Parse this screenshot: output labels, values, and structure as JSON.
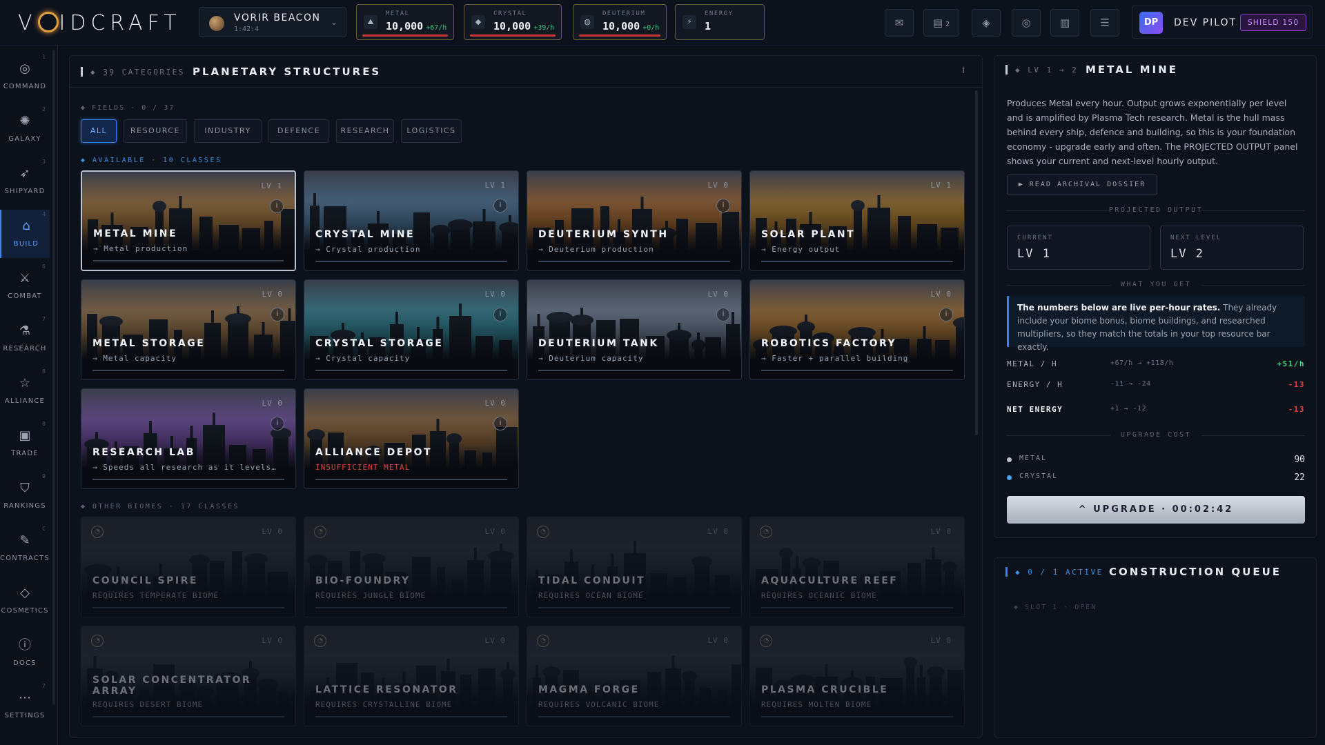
{
  "app": {
    "logo": "VOIDCRAFT"
  },
  "planet": {
    "name": "VORIR BEACON",
    "coords": "1:42:4"
  },
  "resources": [
    {
      "icon": "metal-icon",
      "label": "METAL",
      "value": "10,000",
      "rate": "+67/h"
    },
    {
      "icon": "crystal-icon",
      "label": "CRYSTAL",
      "value": "10,000",
      "rate": "+39/h"
    },
    {
      "icon": "deuterium-icon",
      "label": "DEUTERIUM",
      "value": "10,000",
      "rate": "+0/h"
    },
    {
      "icon": "energy-icon",
      "label": "ENERGY",
      "value": "1",
      "rate": ""
    }
  ],
  "topbar": {
    "buttons": [
      "mail-icon",
      "clipboard-icon",
      "gem-icon",
      "globe-icon",
      "book-icon",
      "menu-icon"
    ],
    "clipboard_count": "2"
  },
  "pilot": {
    "avatar": "DP",
    "name": "DEV PILOT",
    "shield": "SHIELD 150"
  },
  "sidebar": {
    "items": [
      {
        "num": "1",
        "icon": "target-icon",
        "label": "COMMAND"
      },
      {
        "num": "2",
        "icon": "galaxy-icon",
        "label": "GALAXY"
      },
      {
        "num": "3",
        "icon": "rocket-icon",
        "label": "SHIPYARD"
      },
      {
        "num": "4",
        "icon": "build-icon",
        "label": "BUILD"
      },
      {
        "num": "6",
        "icon": "sword-icon",
        "label": "COMBAT"
      },
      {
        "num": "7",
        "icon": "flask-icon",
        "label": "RESEARCH"
      },
      {
        "num": "8",
        "icon": "star-icon",
        "label": "ALLIANCE"
      },
      {
        "num": "0",
        "icon": "bag-icon",
        "label": "TRADE"
      },
      {
        "num": "9",
        "icon": "shield-icon",
        "label": "RANKINGS"
      },
      {
        "num": "C",
        "icon": "pen-icon",
        "label": "CONTRACTS"
      },
      {
        "num": "",
        "icon": "diamond-icon",
        "label": "COSMETICS"
      },
      {
        "num": "",
        "icon": "info-icon",
        "label": "DOCS"
      },
      {
        "num": "7",
        "icon": "dots-icon",
        "label": "SETTINGS"
      }
    ]
  },
  "main": {
    "count": "◆ 39 CATEGORIES",
    "title": "PLANETARY STRUCTURES",
    "info": "i",
    "fields": "◆ FIELDS · 0 / 37",
    "tabs": [
      "ALL",
      "RESOURCE",
      "INDUSTRY",
      "DEFENCE",
      "RESEARCH",
      "LOGISTICS"
    ],
    "available_label": "◆ AVAILABLE · 10 CLASSES",
    "other_label": "◆ OTHER BIOMES · 17 CLASSES",
    "available": [
      {
        "name": "METAL MINE",
        "sub": "→ Metal production",
        "lv": "LV 1",
        "accent": "#c88a3a"
      },
      {
        "name": "CRYSTAL MINE",
        "sub": "→ Crystal production",
        "lv": "LV 1",
        "accent": "#5a8ab0"
      },
      {
        "name": "DEUTERIUM SYNTH",
        "sub": "→ Deuterium production",
        "lv": "LV 0",
        "accent": "#c8782a"
      },
      {
        "name": "SOLAR PLANT",
        "sub": "→ Energy output",
        "lv": "LV 1",
        "accent": "#d0902a"
      },
      {
        "name": "METAL STORAGE",
        "sub": "→ Metal capacity",
        "lv": "LV 0",
        "accent": "#b8864a"
      },
      {
        "name": "CRYSTAL STORAGE",
        "sub": "→ Crystal capacity",
        "lv": "LV 0",
        "accent": "#3aa0b0"
      },
      {
        "name": "DEUTERIUM TANK",
        "sub": "→ Deuterium capacity",
        "lv": "LV 0",
        "accent": "#8a9ab0"
      },
      {
        "name": "ROBOTICS FACTORY",
        "sub": "→ Faster + parallel building",
        "lv": "LV 0",
        "accent": "#d08a30"
      },
      {
        "name": "RESEARCH LAB",
        "sub": "→ Speeds all research as it levels…",
        "lv": "LV 0",
        "accent": "#8a5ac0"
      },
      {
        "name": "ALLIANCE DEPOT",
        "sub": "INSUFFICIENT METAL",
        "lv": "LV 0",
        "accent": "#b07a3a"
      }
    ],
    "other": [
      {
        "name": "COUNCIL SPIRE",
        "sub": "REQUIRES TEMPERATE BIOME",
        "lv": "LV 0"
      },
      {
        "name": "BIO-FOUNDRY",
        "sub": "REQUIRES JUNGLE BIOME",
        "lv": "LV 0"
      },
      {
        "name": "TIDAL CONDUIT",
        "sub": "REQUIRES OCEAN BIOME",
        "lv": "LV 0"
      },
      {
        "name": "AQUACULTURE REEF",
        "sub": "REQUIRES OCEANIC BIOME",
        "lv": "LV 0"
      },
      {
        "name": "SOLAR CONCENTRATOR ARRAY",
        "sub": "REQUIRES DESERT BIOME",
        "lv": "LV 0"
      },
      {
        "name": "LATTICE RESONATOR",
        "sub": "REQUIRES CRYSTALLINE BIOME",
        "lv": "LV 0"
      },
      {
        "name": "MAGMA FORGE",
        "sub": "REQUIRES VOLCANIC BIOME",
        "lv": "LV 0"
      },
      {
        "name": "PLASMA CRUCIBLE",
        "sub": "REQUIRES MOLTEN BIOME",
        "lv": "LV 0"
      }
    ]
  },
  "detail": {
    "sub": "◆ LV 1 → 2",
    "title": "METAL MINE",
    "desc": "Produces Metal every hour. Output grows exponentially per level and is amplified by Plasma Tech research. Metal is the hull mass behind every ship, defence and building, so this is your foundation economy - upgrade early and often. The PROJECTED OUTPUT panel shows your current and next-level hourly output.",
    "dossier": "▶ READ ARCHIVAL DOSSIER",
    "projected_label": "PROJECTED OUTPUT",
    "current_label": "CURRENT",
    "current_value": "LV 1",
    "next_label": "NEXT LEVEL",
    "next_value": "LV 2",
    "what_label": "WHAT YOU GET",
    "note_bold": "The numbers below are live per-hour rates.",
    "note_rest": " They already include your biome bonus, biome buildings, and researched multipliers, so they match the totals in your top resource bar exactly.",
    "rows": [
      {
        "k": "METAL / H",
        "m": "+67/h → +118/h",
        "v": "+51/h",
        "tone": "pos"
      },
      {
        "k": "ENERGY / H",
        "m": "-11 → -24",
        "v": "-13",
        "tone": "neg"
      },
      {
        "k": "NET ENERGY",
        "m": "+1 → -12",
        "v": "-13",
        "tone": "neg"
      }
    ],
    "cost_label": "UPGRADE COST",
    "costs": [
      {
        "k": "METAL",
        "v": "90",
        "color": "#b8c2d0"
      },
      {
        "k": "CRYSTAL",
        "v": "22",
        "color": "#4aa8f0"
      }
    ],
    "upgrade": "^ UPGRADE · 00:02:42"
  },
  "queue": {
    "sub": "◆ 0 / 1 ACTIVE",
    "title": "CONSTRUCTION QUEUE",
    "slot": "◆ SLOT 1 · OPEN"
  }
}
